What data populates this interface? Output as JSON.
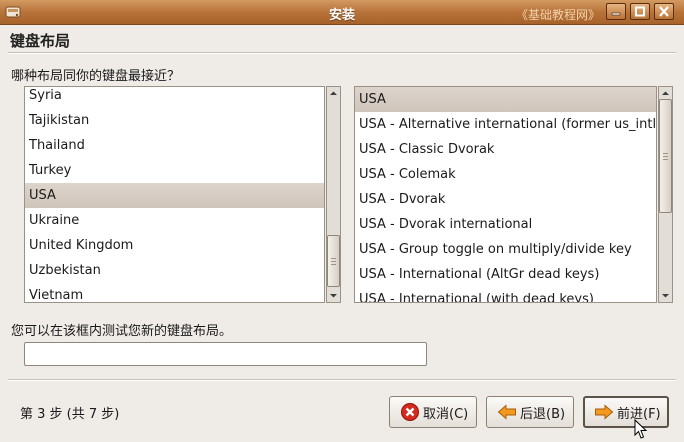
{
  "window": {
    "title": "安装",
    "watermark": "《基础教程网》"
  },
  "page": {
    "heading": "键盘布局",
    "question": "哪种布局同你的键盘最接近？"
  },
  "countries": {
    "items": [
      "Syria",
      "Tajikistan",
      "Thailand",
      "Turkey",
      "USA",
      "Ukraine",
      "United Kingdom",
      "Uzbekistan",
      "Vietnam"
    ],
    "selected": "USA"
  },
  "variants": {
    "items": [
      "USA",
      "USA - Alternative international (former us_intl)",
      "USA - Classic Dvorak",
      "USA - Colemak",
      "USA - Dvorak",
      "USA - Dvorak international",
      "USA - Group toggle on multiply/divide key",
      "USA - International (AltGr dead keys)",
      "USA - International (with dead keys)"
    ],
    "selected": "USA"
  },
  "test": {
    "label": "您可以在该框内测试您新的键盘布局。",
    "value": ""
  },
  "footer": {
    "step": "第 3 步 (共 7 步)",
    "cancel_label": "取消(C)",
    "back_label": "后退(B)",
    "forward_label": "前进(F)"
  },
  "colors": {
    "titlebar": "#b8733a",
    "selection": "#d6cdc4",
    "background": "#efebe7"
  },
  "icons": {
    "cancel": "cancel-icon",
    "back": "back-arrow-icon",
    "forward": "forward-arrow-icon"
  }
}
